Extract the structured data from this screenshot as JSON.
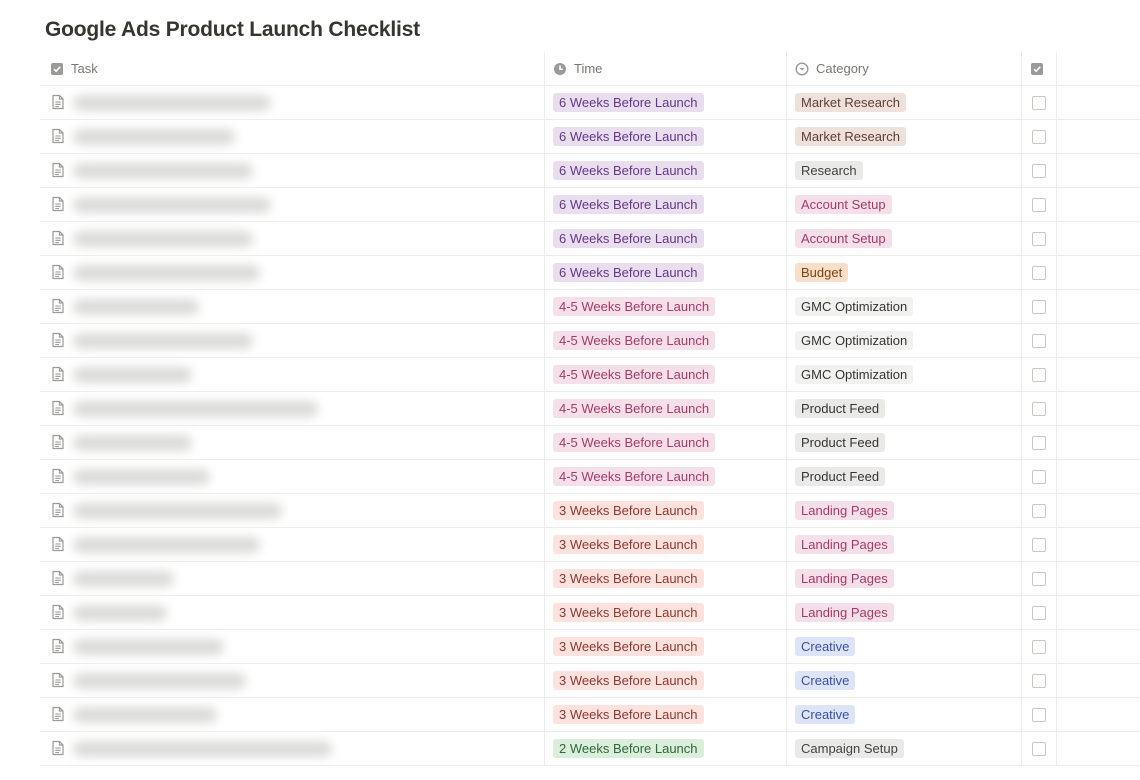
{
  "page": {
    "title": "Google Ads Product Launch Checklist"
  },
  "columns": {
    "task": "Task",
    "time": "Time",
    "category": "Category"
  },
  "colors": {
    "6 Weeks Before Launch": {
      "bg": "#e8deee",
      "fg": "#65378a"
    },
    "4-5 Weeks Before Launch": {
      "bg": "#f5e0e9",
      "fg": "#a63b6b"
    },
    "3 Weeks Before Launch": {
      "bg": "#ffe2dd",
      "fg": "#8c3a32"
    },
    "2 Weeks Before Launch": {
      "bg": "#dbeddb",
      "fg": "#2d6a3a"
    },
    "Market Research": {
      "bg": "#eee0da",
      "fg": "#5e4134"
    },
    "Research": {
      "bg": "#e9e9e7",
      "fg": "#44433f"
    },
    "Account Setup": {
      "bg": "#f5e0e9",
      "fg": "#a63b6b"
    },
    "Budget": {
      "bg": "#fadec9",
      "fg": "#7a4614"
    },
    "GMC Optimization": {
      "bg": "#f1f1ef",
      "fg": "#37352f"
    },
    "Product Feed": {
      "bg": "#e9e9e7",
      "fg": "#37352f"
    },
    "Landing Pages": {
      "bg": "#f5e0e9",
      "fg": "#a63b6b"
    },
    "Creative": {
      "bg": "#dde4f8",
      "fg": "#3b4fa3"
    },
    "Campaign Setup": {
      "bg": "#e9e9e7",
      "fg": "#44433f"
    }
  },
  "rows": [
    {
      "time": "6 Weeks Before Launch",
      "category": "Market Research",
      "checked": false,
      "blur_w": 0.55
    },
    {
      "time": "6 Weeks Before Launch",
      "category": "Market Research",
      "checked": false,
      "blur_w": 0.45
    },
    {
      "time": "6 Weeks Before Launch",
      "category": "Research",
      "checked": false,
      "blur_w": 0.5
    },
    {
      "time": "6 Weeks Before Launch",
      "category": "Account Setup",
      "checked": false,
      "blur_w": 0.55
    },
    {
      "time": "6 Weeks Before Launch",
      "category": "Account Setup",
      "checked": false,
      "blur_w": 0.5
    },
    {
      "time": "6 Weeks Before Launch",
      "category": "Budget",
      "checked": false,
      "blur_w": 0.52
    },
    {
      "time": "4-5 Weeks Before Launch",
      "category": "GMC Optimization",
      "checked": false,
      "blur_w": 0.35
    },
    {
      "time": "4-5 Weeks Before Launch",
      "category": "GMC Optimization",
      "checked": false,
      "blur_w": 0.5
    },
    {
      "time": "4-5 Weeks Before Launch",
      "category": "GMC Optimization",
      "checked": false,
      "blur_w": 0.33
    },
    {
      "time": "4-5 Weeks Before Launch",
      "category": "Product Feed",
      "checked": false,
      "blur_w": 0.68
    },
    {
      "time": "4-5 Weeks Before Launch",
      "category": "Product Feed",
      "checked": false,
      "blur_w": 0.33
    },
    {
      "time": "4-5 Weeks Before Launch",
      "category": "Product Feed",
      "checked": false,
      "blur_w": 0.38
    },
    {
      "time": "3 Weeks Before Launch",
      "category": "Landing Pages",
      "checked": false,
      "blur_w": 0.58
    },
    {
      "time": "3 Weeks Before Launch",
      "category": "Landing Pages",
      "checked": false,
      "blur_w": 0.52
    },
    {
      "time": "3 Weeks Before Launch",
      "category": "Landing Pages",
      "checked": false,
      "blur_w": 0.28
    },
    {
      "time": "3 Weeks Before Launch",
      "category": "Landing Pages",
      "checked": false,
      "blur_w": 0.26
    },
    {
      "time": "3 Weeks Before Launch",
      "category": "Creative",
      "checked": false,
      "blur_w": 0.42
    },
    {
      "time": "3 Weeks Before Launch",
      "category": "Creative",
      "checked": false,
      "blur_w": 0.48
    },
    {
      "time": "3 Weeks Before Launch",
      "category": "Creative",
      "checked": false,
      "blur_w": 0.4
    },
    {
      "time": "2 Weeks Before Launch",
      "category": "Campaign Setup",
      "checked": false,
      "blur_w": 0.72
    }
  ]
}
